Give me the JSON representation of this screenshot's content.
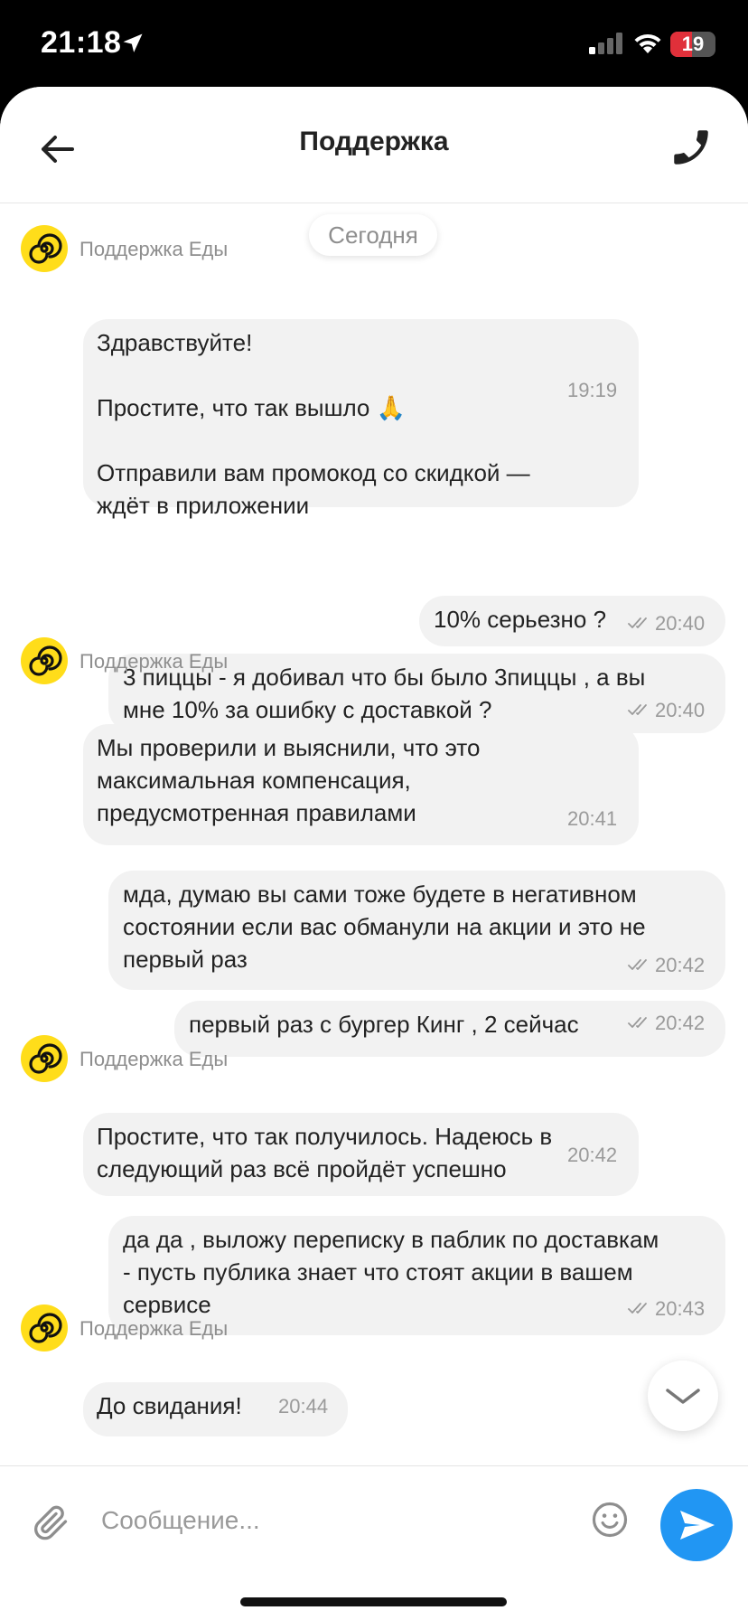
{
  "status_bar": {
    "time": "21:18",
    "battery_level": 19,
    "battery_color": "#e0303a"
  },
  "header": {
    "title": "Поддержка",
    "back_icon": "arrow-left-icon",
    "phone_icon": "phone-icon"
  },
  "chat": {
    "date_label": "Сегодня",
    "messages": [
      {
        "from": "support",
        "sender": "Поддержка Еды",
        "text": "Здравствуйте!\n\nПростите, что так вышло 🙏\n\nОтправили вам промокод со скидкой —\nждёт в приложении",
        "time": "19:19"
      },
      {
        "from": "user",
        "text": "10% серьезно ?",
        "time": "20:40",
        "status": "read"
      },
      {
        "from": "user",
        "text": "3 пиццы - я добивал что бы было 3пиццы , а вы\nмне 10% за ошибку с доставкой ?",
        "time": "20:40",
        "status": "read"
      },
      {
        "from": "support",
        "sender": "Поддержка Еды",
        "text": "Мы проверили и выяснили, что это\nмаксимальная компенсация,\nпредусмотренная правилами",
        "time": "20:41"
      },
      {
        "from": "user",
        "text": "мда, думаю вы сами тоже будете в негативном\nсостоянии если вас обманули на акции и это не\nпервый раз",
        "time": "20:42",
        "status": "read"
      },
      {
        "from": "user",
        "text": "первый раз с бургер Кинг , 2 сейчас",
        "time": "20:42",
        "status": "read"
      },
      {
        "from": "support",
        "sender": "Поддержка Еды",
        "text": "Простите, что так получилось. Надеюсь в\nследующий раз всё пройдёт успешно",
        "time": "20:42"
      },
      {
        "from": "user",
        "text": "да да , выложу переписку в паблик по доставкам\n- пусть публика знает что стоят акции в вашем\nсервисе",
        "time": "20:43",
        "status": "read"
      },
      {
        "from": "support",
        "sender": "Поддержка Еды",
        "text": "До свидания!",
        "time": "20:44"
      }
    ]
  },
  "composer": {
    "placeholder": "Сообщение...",
    "attach_icon": "paperclip-icon",
    "emoji_icon": "smiley-icon",
    "send_icon": "send-icon",
    "send_color": "#2196f3"
  },
  "colors": {
    "avatar": "#ffdd1a",
    "bubble": "#f2f2f2"
  }
}
